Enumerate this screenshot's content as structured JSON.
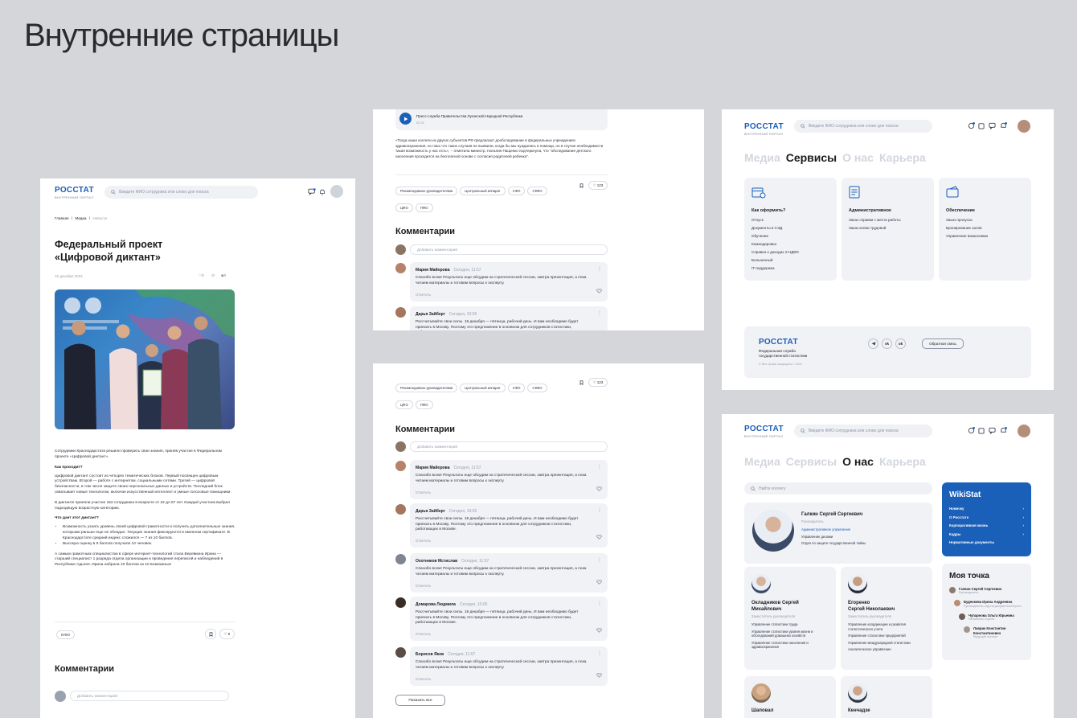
{
  "page_title": "Внутренние страницы",
  "brand": {
    "name": "РОССТАТ",
    "subtitle": "ВНУТРЕННИЙ ПОРТАЛ",
    "accent": "#1a5fb8"
  },
  "search_placeholder": "Введите ФИО сотрудника или слово для поиска",
  "article": {
    "breadcrumb": [
      "Главная",
      "Медиа",
      "Новости"
    ],
    "title_line1": "Федеральный проект",
    "title_line2": "«Цифровой диктант»",
    "date": "15 декабря 2023",
    "likes": "0",
    "comments": "0",
    "views": "0",
    "intro": "Сотрудники Краснодарстата решили проверить свои знания, приняв участие в Федеральном проекте «Цифровой диктант».",
    "h_how": "Как проходит?",
    "p_how": "Цифровой диктант состоит из четырех тематических блоков. Первый посвящен цифровым устройствам. Второй — работе с интернетом, социальными сетями. Третий — цифровой безопасности, в том числе защите своих персональных данных и устройств. Последний блок охватывает новые технологии, включая искусственный интеллект и умные голосовые помощники.",
    "p_part": "В диктанте приняли участие 152 сотрудника в возрасте от 22 до 67 лет. Каждый участник выбрал подходящую возрастную категорию.",
    "h_give": "Что дает этот диктант?",
    "bullet1": "Возможность узнать уровень своей цифровой грамотности и получить дополнительные знания, которыми раньше еще не обладал. Текущие знания фиксируются в именном сертификате. В Краснодарстате средний индекс сложился — 7 из 10 баллов.",
    "bullet2": "Высокую оценку в 9 баллов получили 10 человек.",
    "p_final": "А самым грамотным специалистом в сфере интернет-технологий стала Веревкина Ирина — старший специалист 1 разряда отдела организации и проведения переписей и наблюдений в Республике Адыгея. Ирина набрала 10 баллов из 10 возможных!",
    "tag": "ЮФО",
    "bottom_likes": "0",
    "comments_title": "Комментарии",
    "add_comment": "Добавить комментарий"
  },
  "audio": {
    "source": "Пресс-служба Правительства Луганской Народной Республики",
    "duration": "00:32",
    "quote": "«Тогда наши коллеги из других субъектов РФ предлагают дообследование в федеральных учреждениях здравоохранения, но пока что таких случаев не выявили, когда бы мы нуждались в помощи, но в случае необходимости такая возможность у нас есть», – отметила министр. Наталия Пащенко подчеркнула, что \"обследование детского населения проходится на бесплатной основе с согласия родителей ребенка\"."
  },
  "tags": [
    "Рекомендовано руководителями",
    "Центральный аппарат",
    "СФО",
    "СКФО",
    "ЦФО",
    "ПФО"
  ],
  "likes_count": "123",
  "comments_section": {
    "title": "Комментарии",
    "add_placeholder": "Добавить комментарий",
    "reply": "Ответить",
    "show_all": "Показать все",
    "items": [
      {
        "name": "Мария Майорова",
        "time": "Сегодня, 11:57",
        "text": "Спасибо всем! Результаты еще обсудим на стратегической сессии, завтра презентация, а пока читаем материалы и готовим вопросы к эксперту."
      },
      {
        "name": "Дарья Зайберг",
        "time": "Сегодня, 10:05",
        "text": "Рассчитывайте свои силы. 18 декабря — пятница, рабочий день. И вам необходимо будет приехать в Москву. Поэтому это предложение в основном для сотрудников статистики, работающих в Москве."
      },
      {
        "name": "Охотников Мстислав",
        "time": "Сегодня, 11:57",
        "text": "Спасибо всем! Результаты еще обсудим на стратегической сессии, завтра презентация, а пока читаем материалы и готовим вопросы к эксперту."
      },
      {
        "name": "Домарова Людмила",
        "time": "Сегодня, 10:05",
        "text": "Рассчитывайте свои силы. 18 декабря — пятница, рабочий день. И вам необходимо будет приехать в Москву. Поэтому это предложение в основном для сотрудников статистики, работающих в Москве."
      },
      {
        "name": "Борисов Яков",
        "time": "Сегодня, 11:57",
        "text": "Спасибо всем! Результаты еще обсудим на стратегической сессии, завтра презентация, а пока читаем материалы и готовим вопросы к эксперту."
      }
    ]
  },
  "nav": [
    "Медиа",
    "Сервисы",
    "О нас",
    "Карьера"
  ],
  "services": {
    "card1": {
      "title": "Как оформить?",
      "items": [
        "Отпуск",
        "Документы в СЭД",
        "Обучение",
        "Командировка",
        "Справка о доходах 2-НДФЛ",
        "Больничный",
        "IT-поддержка"
      ]
    },
    "card2": {
      "title": "Административное",
      "items": [
        "Заказ справки с места работы",
        "Заказ копии трудовой"
      ]
    },
    "card3": {
      "title": "Обеспечение",
      "items": [
        "Заказ пропуска",
        "Бронирование залов",
        "Управление вакансиями"
      ]
    }
  },
  "footer": {
    "org_line1": "Федеральная служба",
    "org_line2": "государственной статистики",
    "copyright": "© Все права защищены • 2023",
    "feedback": "Обратная связь"
  },
  "about": {
    "search_placeholder": "Найти коллегу",
    "head": {
      "name": "Галкин Сергей Сергеевич",
      "role": "Руководитель",
      "links": [
        "Административное управление",
        "Управление делами",
        "Отдел по защите государственной тайны"
      ]
    },
    "deputies": [
      {
        "name1": "Окладников Сергей",
        "name2": "Михайлович",
        "role": "Заместитель руководителя",
        "items": [
          "Управление статистики труда",
          "Управление статистики уровня жизни и обследований домашних хозяйств",
          "Управление статистики населения и здравоохранения"
        ]
      },
      {
        "name1": "Егоренко",
        "name2": "Сергей Николаевич",
        "role": "Заместитель руководителя",
        "items": [
          "Управление координации и развития статистического учета",
          "Управление статистики предприятий",
          "Управление международной статистики",
          "Аналитическое управление"
        ]
      }
    ],
    "bottom_people": [
      "Шаповал",
      "Кенчадзе"
    ],
    "wiki": {
      "title": "WikiStat",
      "items": [
        "Новичку",
        "О Росстате",
        "Корпоративная жизнь",
        "Кадры",
        "Нормативные документы"
      ]
    },
    "my_point": {
      "title": "Моя точка",
      "items": [
        {
          "name": "Галкин Сергей Сергеевич",
          "role": "Руководитель"
        },
        {
          "name": "Буденкова Ирина Андреевна",
          "role": "Руководитель отдела документооборота"
        },
        {
          "name": "Чупарнова Ольга Юрьевна",
          "role": "Начальник отдела"
        },
        {
          "name": "Лаврик Константин Константинович",
          "role": "Ведущий эксперт"
        }
      ]
    }
  }
}
